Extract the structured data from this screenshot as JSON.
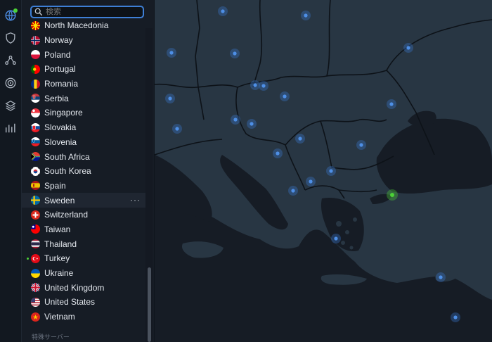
{
  "search": {
    "placeholder": "検索"
  },
  "rail": {
    "items": [
      "globe-icon",
      "shield-icon",
      "mesh-network-icon",
      "threat-target-icon",
      "layers-icon",
      "stats-icon"
    ]
  },
  "countries": [
    {
      "name": "North Macedonia",
      "flag": "mk"
    },
    {
      "name": "Norway",
      "flag": "no"
    },
    {
      "name": "Poland",
      "flag": "pl"
    },
    {
      "name": "Portugal",
      "flag": "pt"
    },
    {
      "name": "Romania",
      "flag": "ro"
    },
    {
      "name": "Serbia",
      "flag": "rs"
    },
    {
      "name": "Singapore",
      "flag": "sg"
    },
    {
      "name": "Slovakia",
      "flag": "sk"
    },
    {
      "name": "Slovenia",
      "flag": "si"
    },
    {
      "name": "South Africa",
      "flag": "za"
    },
    {
      "name": "South Korea",
      "flag": "kr"
    },
    {
      "name": "Spain",
      "flag": "es"
    },
    {
      "name": "Sweden",
      "flag": "se",
      "selected": true
    },
    {
      "name": "Switzerland",
      "flag": "ch"
    },
    {
      "name": "Taiwan",
      "flag": "tw"
    },
    {
      "name": "Thailand",
      "flag": "th"
    },
    {
      "name": "Turkey",
      "flag": "tr",
      "connected": true
    },
    {
      "name": "Ukraine",
      "flag": "ua"
    },
    {
      "name": "United Kingdom",
      "flag": "gb"
    },
    {
      "name": "United States",
      "flag": "us"
    },
    {
      "name": "Vietnam",
      "flag": "vn"
    }
  ],
  "more_label": "···",
  "section_label": "特殊サーバー",
  "colors": {
    "accent": "#3e7fd6",
    "connected": "#4cd137",
    "map_land": "#283643",
    "map_sea": "#161c25"
  }
}
